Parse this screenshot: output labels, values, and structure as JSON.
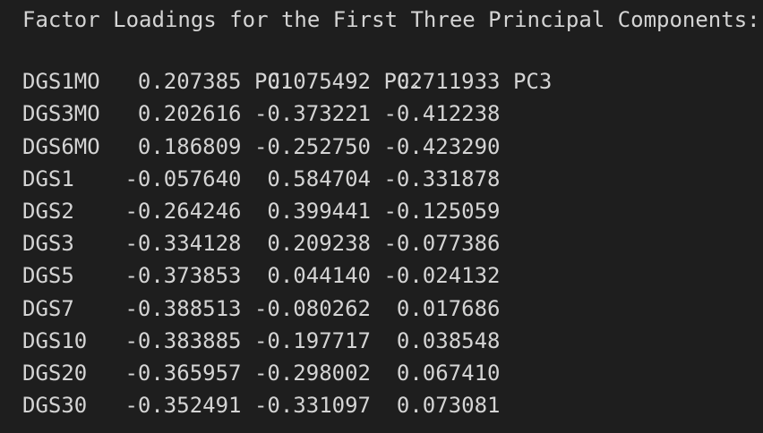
{
  "title": "Factor Loadings for the First Three Principal Components:",
  "columns": [
    "PC1",
    "PC2",
    "PC3"
  ],
  "rows": [
    {
      "label": "DGS1MO",
      "values": [
        "0.207385",
        "0.075492",
        "0.711933"
      ]
    },
    {
      "label": "DGS3MO",
      "values": [
        "0.202616",
        "-0.373221",
        "-0.412238"
      ]
    },
    {
      "label": "DGS6MO",
      "values": [
        "0.186809",
        "-0.252750",
        "-0.423290"
      ]
    },
    {
      "label": "DGS1",
      "values": [
        "-0.057640",
        "0.584704",
        "-0.331878"
      ]
    },
    {
      "label": "DGS2",
      "values": [
        "-0.264246",
        "0.399441",
        "-0.125059"
      ]
    },
    {
      "label": "DGS3",
      "values": [
        "-0.334128",
        "0.209238",
        "-0.077386"
      ]
    },
    {
      "label": "DGS5",
      "values": [
        "-0.373853",
        "0.044140",
        "-0.024132"
      ]
    },
    {
      "label": "DGS7",
      "values": [
        "-0.388513",
        "-0.080262",
        "0.017686"
      ]
    },
    {
      "label": "DGS10",
      "values": [
        "-0.383885",
        "-0.197717",
        "0.038548"
      ]
    },
    {
      "label": "DGS20",
      "values": [
        "-0.365957",
        "-0.298002",
        "0.067410"
      ]
    },
    {
      "label": "DGS30",
      "values": [
        "-0.352491",
        "-0.331097",
        "0.073081"
      ]
    }
  ]
}
